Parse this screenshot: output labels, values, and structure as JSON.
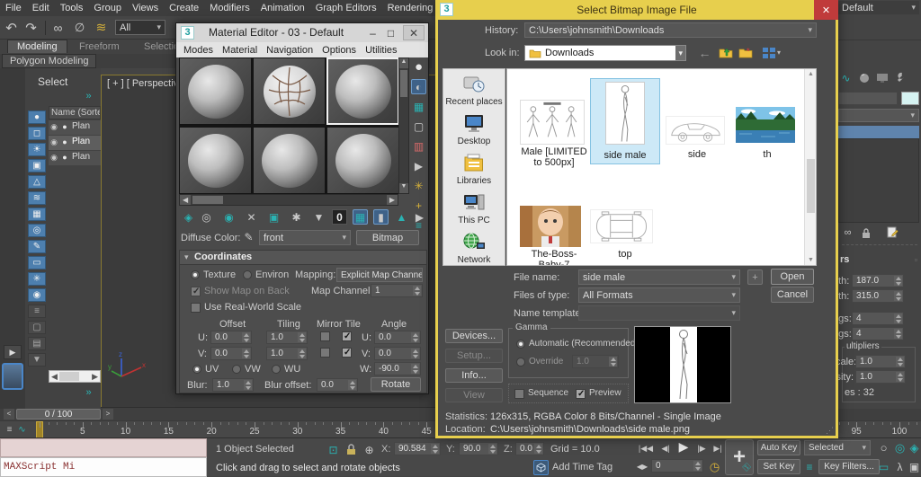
{
  "colors": {
    "teal": "#2ab3b3",
    "titlebar_yellow": "#e7cf4d",
    "close_red": "#c03b3b",
    "selection_blue": "#cde9f7"
  },
  "menubar": {
    "items": [
      "File",
      "Edit",
      "Tools",
      "Group",
      "Views",
      "Create",
      "Modifiers",
      "Animation",
      "Graph Editors",
      "Rendering"
    ]
  },
  "toolbar": {
    "filter_value": "All"
  },
  "ribbon": {
    "tabs": [
      "Modeling",
      "Freeform",
      "Selection"
    ],
    "subtab": "Polygon Modeling"
  },
  "explorer": {
    "title": "Select",
    "column_header": "Name (Sorted A",
    "rows": [
      "Plan",
      "Plan",
      "Plan"
    ]
  },
  "viewport": {
    "label": "[ + ] [ Perspective ] [ S"
  },
  "material_editor": {
    "title": "Material Editor - 03 - Default",
    "menus": [
      "Modes",
      "Material",
      "Navigation",
      "Options",
      "Utilities"
    ],
    "diffuse_label": "Diffuse Color:",
    "map_name": "front",
    "bitmap_button": "Bitmap",
    "coordinates": {
      "title": "Coordinates",
      "texture_label": "Texture",
      "environ_label": "Environ",
      "mapping_label": "Mapping:",
      "mapping_value": "Explicit Map Channel",
      "show_map_label": "Show Map on Back",
      "map_channel_label": "Map Channel:",
      "map_channel_value": "1",
      "use_rws_label": "Use Real-World Scale",
      "col_offset": "Offset",
      "col_tiling": "Tiling",
      "col_mirror_tile": "Mirror Tile",
      "col_angle": "Angle",
      "u_label": "U:",
      "v_label": "V:",
      "w_label": "W:",
      "u_offset": "0.0",
      "u_tiling": "1.0",
      "u_angle": "0.0",
      "v_offset": "0.0",
      "v_tiling": "1.0",
      "v_angle": "0.0",
      "w_angle": "-90.0",
      "uv_label": "UV",
      "vw_label": "VW",
      "wu_label": "WU",
      "blur_label": "Blur:",
      "blur_value": "1.0",
      "blur_offset_label": "Blur offset:",
      "blur_offset_value": "0.0",
      "rotate_button": "Rotate"
    }
  },
  "dialog": {
    "title": "Select Bitmap Image File",
    "history_label": "History:",
    "history_value": "C:\\Users\\johnsmith\\Downloads",
    "look_in_label": "Look in:",
    "look_in_value": "Downloads",
    "places": [
      "Recent places",
      "Desktop",
      "Libraries",
      "This PC",
      "Network"
    ],
    "files": [
      {
        "name": "Male [LIMITED to 500px]"
      },
      {
        "name": "side male",
        "selected": true
      },
      {
        "name": "side"
      },
      {
        "name": "th"
      },
      {
        "name": "The-Boss-Baby-7"
      },
      {
        "name": "top"
      }
    ],
    "file_name_label": "File name:",
    "file_name_value": "side male",
    "files_of_type_label": "Files of type:",
    "files_of_type_value": "All Formats",
    "name_template_label": "Name template:",
    "plus_button": "+",
    "open_button": "Open",
    "cancel_button": "Cancel",
    "devices_button": "Devices...",
    "setup_button": "Setup...",
    "info_button": "Info...",
    "view_button": "View",
    "gamma_title": "Gamma",
    "gamma_auto": "Automatic (Recommended)",
    "gamma_override": "Override",
    "gamma_override_value": "1.0",
    "sequence_label": "Sequence",
    "preview_label": "Preview",
    "statistics_label": "Statistics:",
    "statistics_value": "126x315, RGBA Color 8 Bits/Channel - Single Image",
    "location_label": "Location:",
    "location_value": "C:\\Users\\johnsmith\\Downloads\\side male.png"
  },
  "right_panel": {
    "workspace": "Default",
    "rollout_title": "rs",
    "fields": [
      {
        "label": "gth:",
        "value": "187.0"
      },
      {
        "label": "dth:",
        "value": "315.0"
      },
      {
        "label": "egs:",
        "value": "4"
      },
      {
        "label": "egs:",
        "value": "4"
      }
    ],
    "group_title": "ultipliers",
    "group_fields": [
      {
        "label": "cale:",
        "value": "1.0"
      },
      {
        "label": "sity:",
        "value": "1.0"
      }
    ],
    "faces_text": "es : 32"
  },
  "timeline": {
    "slider_value": "0 / 100",
    "tick_labels": [
      5,
      10,
      15,
      20,
      25,
      30,
      35,
      40,
      45,
      95,
      100
    ]
  },
  "status_bar": {
    "maxscript_text": "MAXScript Mi",
    "selection_status": "1 Object Selected",
    "prompt": "Click and drag to select and rotate objects",
    "x_label": "X:",
    "x_value": "90.584",
    "y_label": "Y:",
    "y_value": "90.0",
    "z_label": "Z:",
    "z_value": "0.0",
    "grid_text": "Grid = 10.0",
    "add_time_tag": "Add Time Tag",
    "frame_value": "0",
    "auto_key": "Auto Key",
    "set_key": "Set Key",
    "selected_filter": "Selected",
    "key_filters": "Key Filters..."
  },
  "icons": {
    "undo": "↶",
    "redo": "↷",
    "select-link": "∞",
    "unlink": "∅",
    "bind-spacewarp": "≋",
    "geometry": "●",
    "shapes": "◻",
    "lights": "☀",
    "cameras": "▣",
    "helpers": "△",
    "spacewarps": "≋",
    "groups": "▦",
    "xrefs": "◎",
    "bones": "✎",
    "containers": "▭",
    "particles": "✳",
    "visibility": "◉",
    "list": "≡",
    "blank": "▢",
    "detail": "▤",
    "filter": "▼",
    "eye": "◉",
    "radio-dot": "●",
    "get-material": "◈",
    "put-material": "◎",
    "assign-material": "◉",
    "reset-map": "✕",
    "copy-material": "▣",
    "make-unique": "✱",
    "put-library": "▼",
    "id-channel": "0",
    "show-in-viewport": "▦",
    "show-end-result": "▮",
    "go-parent": "▲",
    "go-sibling": "▶",
    "sample-type": "●",
    "backlight": "◐",
    "background": "▦",
    "uv-tiling": "▢",
    "color-check": "▥",
    "make-preview": "▶",
    "options": "✳",
    "select-by-mtl": "+",
    "navigator": "≡",
    "pencil": "✎",
    "back": "←",
    "goto-start": "|◀◀",
    "prev-frame": "◀|",
    "play": "▶",
    "next-frame": "|▶",
    "goto-end": "▶|",
    "frame-arrows": "◀▶",
    "clock": "◷",
    "zoom": "○",
    "zoom-all": "◎",
    "zoom-extents": "◈",
    "fov": "▷",
    "zoom-region": "▭",
    "walk": "λ",
    "orbit": "◔",
    "maximize": "▣",
    "isolate": "⊡",
    "abs-offset": "⊕",
    "key-pose": "≡",
    "chevrons": "»",
    "curve-toggle": "∿",
    "min": "–",
    "max": "□",
    "cross": "✕",
    "tab-curve": "∿",
    "wrench": "⚙"
  }
}
